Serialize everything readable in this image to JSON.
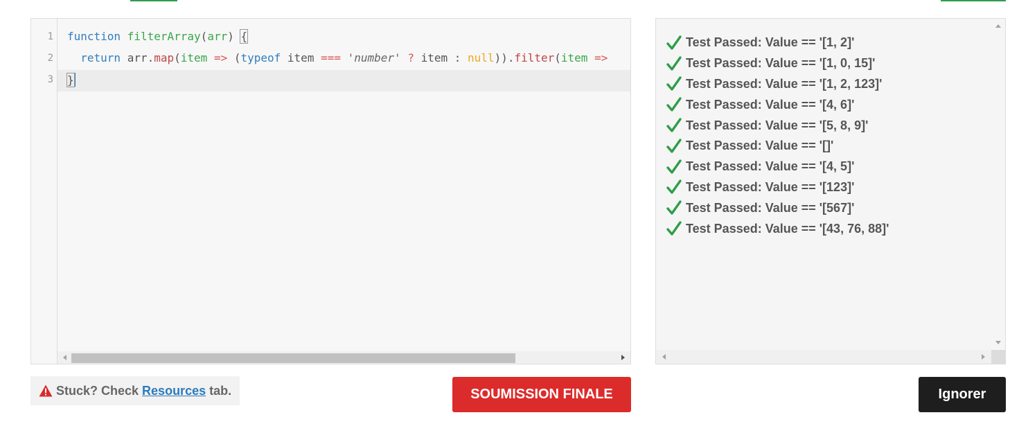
{
  "editor": {
    "line_numbers": [
      "1",
      "2",
      "3"
    ],
    "lines": [
      {
        "tokens": [
          {
            "text": "function",
            "kind": "kw"
          },
          {
            "text": " ",
            "kind": "plain"
          },
          {
            "text": "filterArray",
            "kind": "fn"
          },
          {
            "text": "(",
            "kind": "plain"
          },
          {
            "text": "arr",
            "kind": "fn"
          },
          {
            "text": ") ",
            "kind": "plain"
          },
          {
            "text": "{",
            "kind": "brace"
          }
        ]
      },
      {
        "tokens": [
          {
            "text": "  ",
            "kind": "plain"
          },
          {
            "text": "return",
            "kind": "kw"
          },
          {
            "text": " arr.",
            "kind": "plain"
          },
          {
            "text": "map",
            "kind": "mth"
          },
          {
            "text": "(",
            "kind": "plain"
          },
          {
            "text": "item",
            "kind": "fn"
          },
          {
            "text": " ",
            "kind": "plain"
          },
          {
            "text": "=>",
            "kind": "op"
          },
          {
            "text": " (",
            "kind": "plain"
          },
          {
            "text": "typeof",
            "kind": "kw"
          },
          {
            "text": " item ",
            "kind": "plain"
          },
          {
            "text": "===",
            "kind": "op"
          },
          {
            "text": " ",
            "kind": "plain"
          },
          {
            "text": "'number'",
            "kind": "str"
          },
          {
            "text": " ",
            "kind": "plain"
          },
          {
            "text": "?",
            "kind": "op"
          },
          {
            "text": " item : ",
            "kind": "plain"
          },
          {
            "text": "null",
            "kind": "nl"
          },
          {
            "text": ")).",
            "kind": "plain"
          },
          {
            "text": "filter",
            "kind": "mth"
          },
          {
            "text": "(",
            "kind": "plain"
          },
          {
            "text": "item",
            "kind": "fn"
          },
          {
            "text": " ",
            "kind": "plain"
          },
          {
            "text": "=>",
            "kind": "op"
          }
        ]
      },
      {
        "tokens": [
          {
            "text": "}",
            "kind": "brace"
          },
          {
            "text": "",
            "kind": "cursor"
          }
        ]
      }
    ]
  },
  "output": {
    "results": [
      "Test Passed: Value == '[1, 2]'",
      "Test Passed: Value == '[1, 0, 15]'",
      "Test Passed: Value == '[1, 2, 123]'",
      "Test Passed: Value == '[4, 6]'",
      "Test Passed: Value == '[5, 8, 9]'",
      "Test Passed: Value == '[]'",
      "Test Passed: Value == '[4, 5]'",
      "Test Passed: Value == '[123]'",
      "Test Passed: Value == '[567]'",
      "Test Passed: Value == '[43, 76, 88]'"
    ],
    "result_icon": "check-icon"
  },
  "hint": {
    "icon": "warning-icon",
    "prefix": "Stuck? Check",
    "link": "Resources",
    "suffix": "tab."
  },
  "buttons": {
    "submit_label": "SOUMISSION FINALE",
    "ignore_label": "Ignorer"
  },
  "colors": {
    "pass": "#2e9e48",
    "submit": "#dc2b2b",
    "ignore": "#1e1e1e",
    "link": "#2a7bbd"
  }
}
